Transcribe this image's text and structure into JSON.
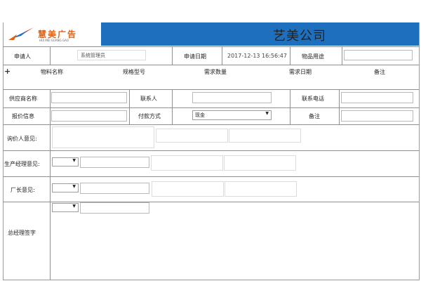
{
  "header": {
    "logo_text": "慧美广告",
    "logo_subtext": "HUI MEI GUANG GAO",
    "company_name": "艺美公司"
  },
  "request_row": {
    "applicant_label": "申请人",
    "applicant_value": "系统管理员",
    "date_label": "申请日期",
    "date_value": "2017-12-13 16:56:47",
    "purpose_label": "物品用途",
    "purpose_value": ""
  },
  "items_table": {
    "add_icon": "plus-icon",
    "columns": [
      "物料名称",
      "规格型号",
      "需求数量",
      "需求日期",
      "备注"
    ]
  },
  "supplier_row": {
    "supplier_label": "供应商名称",
    "contact_label": "联系人",
    "phone_label": "联系电话"
  },
  "quote_row": {
    "quote_label": "报价信息",
    "payment_label": "付款方式",
    "payment_value": "现金",
    "remark_label": "备注"
  },
  "opinions": {
    "inquirer_label": "询价人意见:",
    "production_manager_label": "生产经理意见:",
    "factory_director_label": "厂长意见:",
    "general_manager_label": "总经理签字"
  }
}
